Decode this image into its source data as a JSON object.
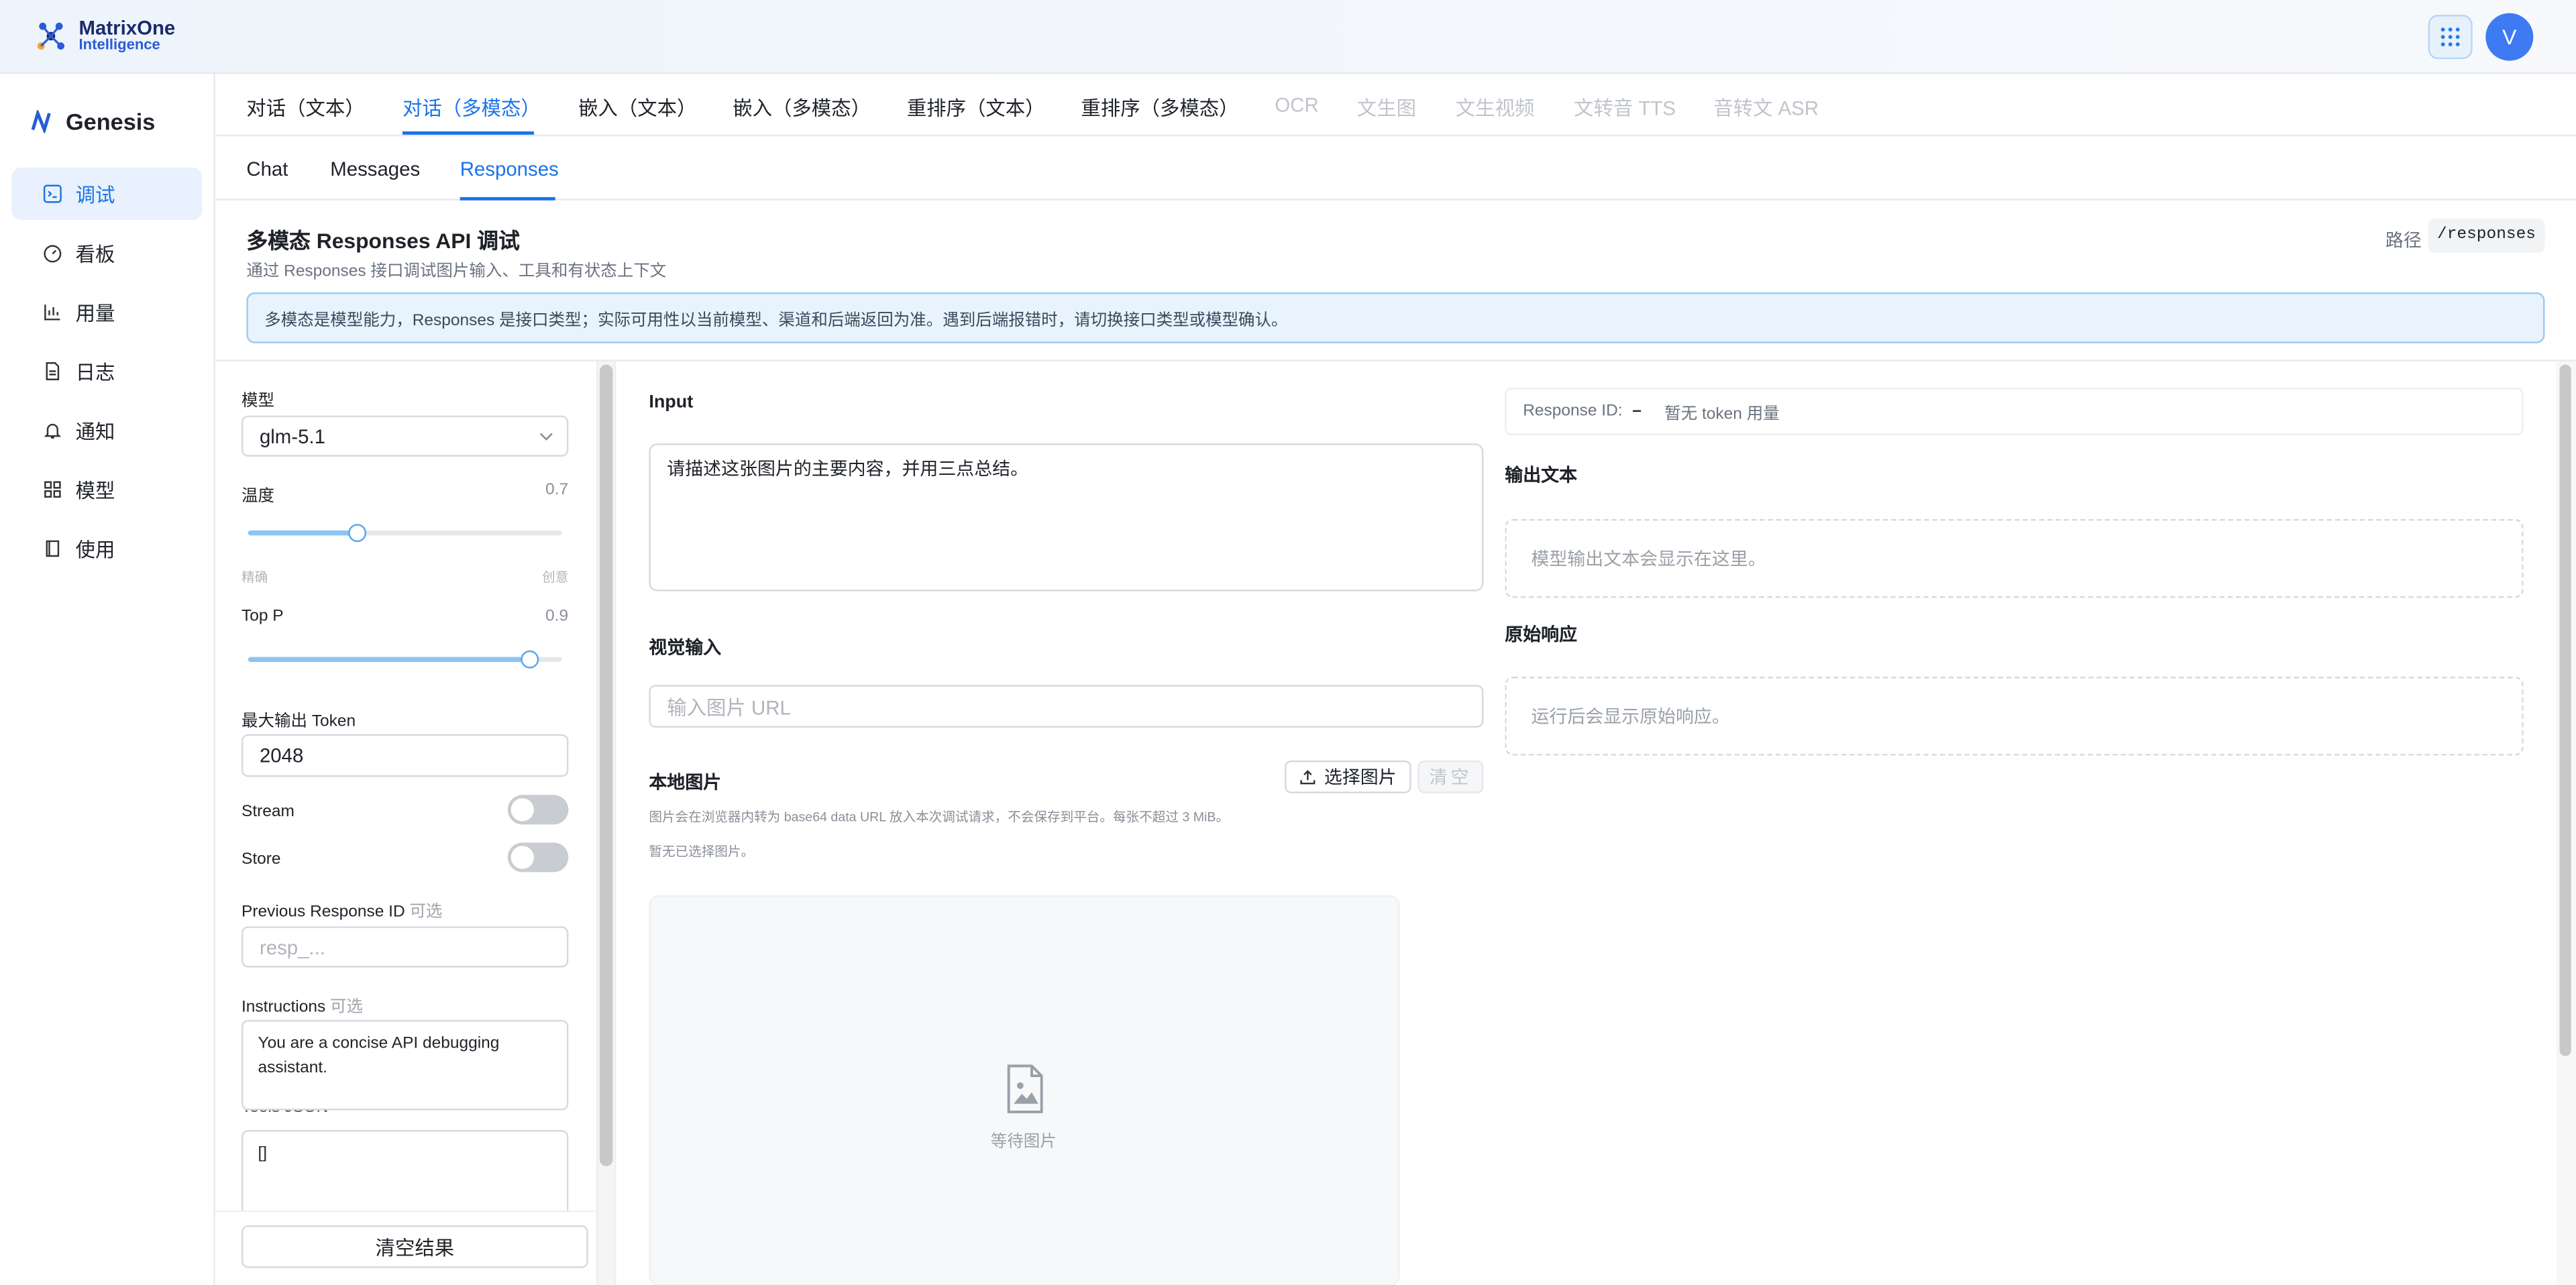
{
  "header": {
    "brand_line1": "MatrixOne",
    "brand_line2": "Intelligence",
    "avatar_letter": "V"
  },
  "sidebar": {
    "title": "Genesis",
    "items": [
      {
        "label": "调试",
        "icon": "terminal-icon",
        "active": true
      },
      {
        "label": "看板",
        "icon": "dashboard-icon"
      },
      {
        "label": "用量",
        "icon": "bar-chart-icon"
      },
      {
        "label": "日志",
        "icon": "document-icon"
      },
      {
        "label": "通知",
        "icon": "bell-icon"
      },
      {
        "label": "模型",
        "icon": "grid-icon"
      },
      {
        "label": "使用",
        "icon": "book-icon"
      }
    ]
  },
  "tabs_primary": [
    {
      "label": "对话（文本）"
    },
    {
      "label": "对话（多模态）",
      "active": true
    },
    {
      "label": "嵌入（文本）"
    },
    {
      "label": "嵌入（多模态）"
    },
    {
      "label": "重排序（文本）"
    },
    {
      "label": "重排序（多模态）"
    },
    {
      "label": "OCR",
      "disabled": true
    },
    {
      "label": "文生图",
      "disabled": true
    },
    {
      "label": "文生视频",
      "disabled": true
    },
    {
      "label": "文转音 TTS",
      "disabled": true
    },
    {
      "label": "音转文 ASR",
      "disabled": true
    }
  ],
  "tabs_secondary": [
    {
      "label": "Chat"
    },
    {
      "label": "Messages"
    },
    {
      "label": "Responses",
      "active": true
    }
  ],
  "page": {
    "title": "多模态 Responses API 调试",
    "subtitle": "通过 Responses 接口调试图片输入、工具和有状态上下文",
    "path_label": "路径",
    "path_value": "/responses",
    "banner": "多模态是模型能力，Responses 是接口类型；实际可用性以当前模型、渠道和后端返回为准。遇到后端报错时，请切换接口类型或模型确认。"
  },
  "params": {
    "model_label": "模型",
    "model_value": "glm-5.1",
    "temp_label": "温度",
    "temp_value": "0.7",
    "temp_min_label": "精确",
    "temp_max_label": "创意",
    "topp_label": "Top P",
    "topp_value": "0.9",
    "maxtok_label": "最大输出 Token",
    "maxtok_value": "2048",
    "stream_label": "Stream",
    "stream_on": false,
    "store_label": "Store",
    "store_on": false,
    "prev_id_label": "Previous Response ID",
    "optional": "可选",
    "prev_id_placeholder": "resp_...",
    "instructions_label": "Instructions",
    "instructions_value": "You are a concise API debugging assistant.",
    "tools_label": "Tools JSON",
    "tools_value": "[]",
    "clear_results": "清空结果"
  },
  "input_panel": {
    "input_label": "Input",
    "input_value": "请描述这张图片的主要内容，并用三点总结。",
    "visual_label": "视觉输入",
    "url_placeholder": "输入图片 URL",
    "local_label": "本地图片",
    "pick_button": "选择图片",
    "clear_button": "清空",
    "hint1": "图片会在浏览器内转为 base64 data URL 放入本次调试请求，不会保存到平台。每张不超过 3 MiB。",
    "hint2": "暂无已选择图片。",
    "drop_text": "等待图片"
  },
  "output_panel": {
    "response_id_label": "Response ID:",
    "response_id_value": "–",
    "token_usage": "暂无 token 用量",
    "output_text_label": "输出文本",
    "output_placeholder": "模型输出文本会显示在这里。",
    "raw_label": "原始响应",
    "raw_placeholder": "运行后会显示原始响应。"
  },
  "colors": {
    "accent": "#1a73e8",
    "banner_bg": "#e8f3fd",
    "avatar": "#3e7bf2"
  }
}
